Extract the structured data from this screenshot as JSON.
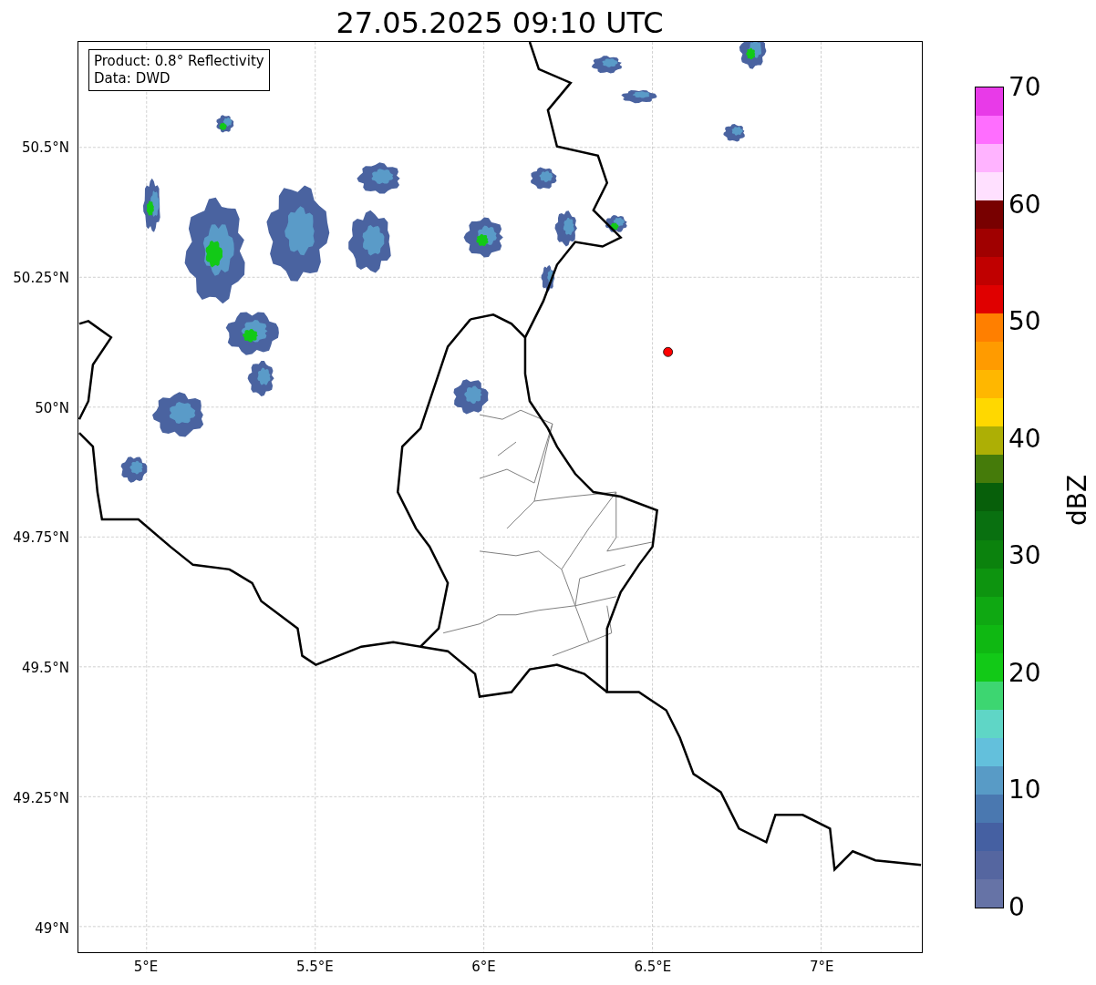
{
  "title": "27.05.2025 09:10 UTC",
  "info_box": {
    "lines": [
      "Product: 0.8° Reflectivity",
      "Data: DWD"
    ]
  },
  "map": {
    "lat_labels": [
      "50.5°N",
      "50.25°N",
      "50°N",
      "49.75°N",
      "49.5°N",
      "49.25°N",
      "49°N"
    ],
    "lon_labels": [
      "5°E",
      "5.5°E",
      "6°E",
      "6.5°E",
      "7°E"
    ]
  },
  "colorbar": {
    "label": "dBZ",
    "tick_labels": [
      "70",
      "60",
      "50",
      "40",
      "30",
      "20",
      "10",
      "0"
    ],
    "segments": [
      {
        "color": "#e83ae8"
      },
      {
        "color": "#ff6eff"
      },
      {
        "color": "#ffb3ff"
      },
      {
        "color": "#ffe0ff"
      },
      {
        "color": "#780000"
      },
      {
        "color": "#a00000"
      },
      {
        "color": "#c00000"
      },
      {
        "color": "#e00000"
      },
      {
        "color": "#ff7f00"
      },
      {
        "color": "#ff9b00"
      },
      {
        "color": "#ffb700"
      },
      {
        "color": "#ffd800"
      },
      {
        "color": "#adaf05"
      },
      {
        "color": "#457b0a"
      },
      {
        "color": "#075f0a"
      },
      {
        "color": "#097010"
      },
      {
        "color": "#0b820d"
      },
      {
        "color": "#0d940f"
      },
      {
        "color": "#0fa812"
      },
      {
        "color": "#0fb812"
      },
      {
        "color": "#12c917"
      },
      {
        "color": "#3dd671"
      },
      {
        "color": "#5fd6c6"
      },
      {
        "color": "#63c0dc"
      },
      {
        "color": "#589bc6"
      },
      {
        "color": "#4a78b0"
      },
      {
        "color": "#4560a2"
      },
      {
        "color": "#5566a0"
      },
      {
        "color": "#6673a6"
      }
    ]
  }
}
